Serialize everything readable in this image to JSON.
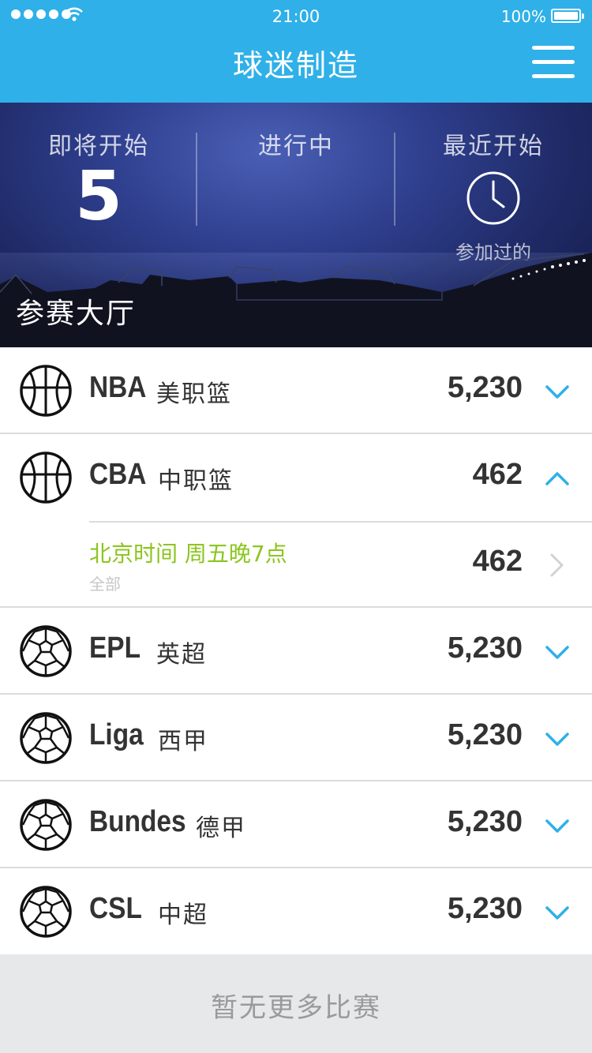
{
  "status_bar": {
    "time": "21:00",
    "battery": "100%"
  },
  "header": {
    "title": "球迷制造"
  },
  "hero": {
    "upcoming_label": "即将开始",
    "upcoming_count": "5",
    "live_label": "进行中",
    "recent_label": "最近开始",
    "recent_sub": "参加过的",
    "hall_title": "参赛大厅"
  },
  "leagues": [
    {
      "code": "NBA",
      "name": "美职篮",
      "count": "5,230",
      "sport": "basketball",
      "expanded": false
    },
    {
      "code": "CBA",
      "name": "中职篮",
      "count": "462",
      "sport": "basketball",
      "expanded": true
    },
    {
      "code": "EPL",
      "name": "英超",
      "count": "5,230",
      "sport": "soccer",
      "expanded": false
    },
    {
      "code": "Liga",
      "name": "西甲",
      "count": "5,230",
      "sport": "soccer",
      "expanded": false
    },
    {
      "code": "Bundes",
      "name": "德甲",
      "count": "5,230",
      "sport": "soccer",
      "expanded": false
    },
    {
      "code": "CSL",
      "name": "中超",
      "count": "5,230",
      "sport": "soccer",
      "expanded": false
    }
  ],
  "cba_sub": {
    "time_text": "北京时间 周五晚7点",
    "filter": "全部",
    "count": "462"
  },
  "footer": {
    "text": "暂无更多比赛"
  },
  "colors": {
    "accent": "#2fb0e8",
    "green": "#8bc61e",
    "chevron": "#2fb0e8",
    "text": "#333333"
  }
}
